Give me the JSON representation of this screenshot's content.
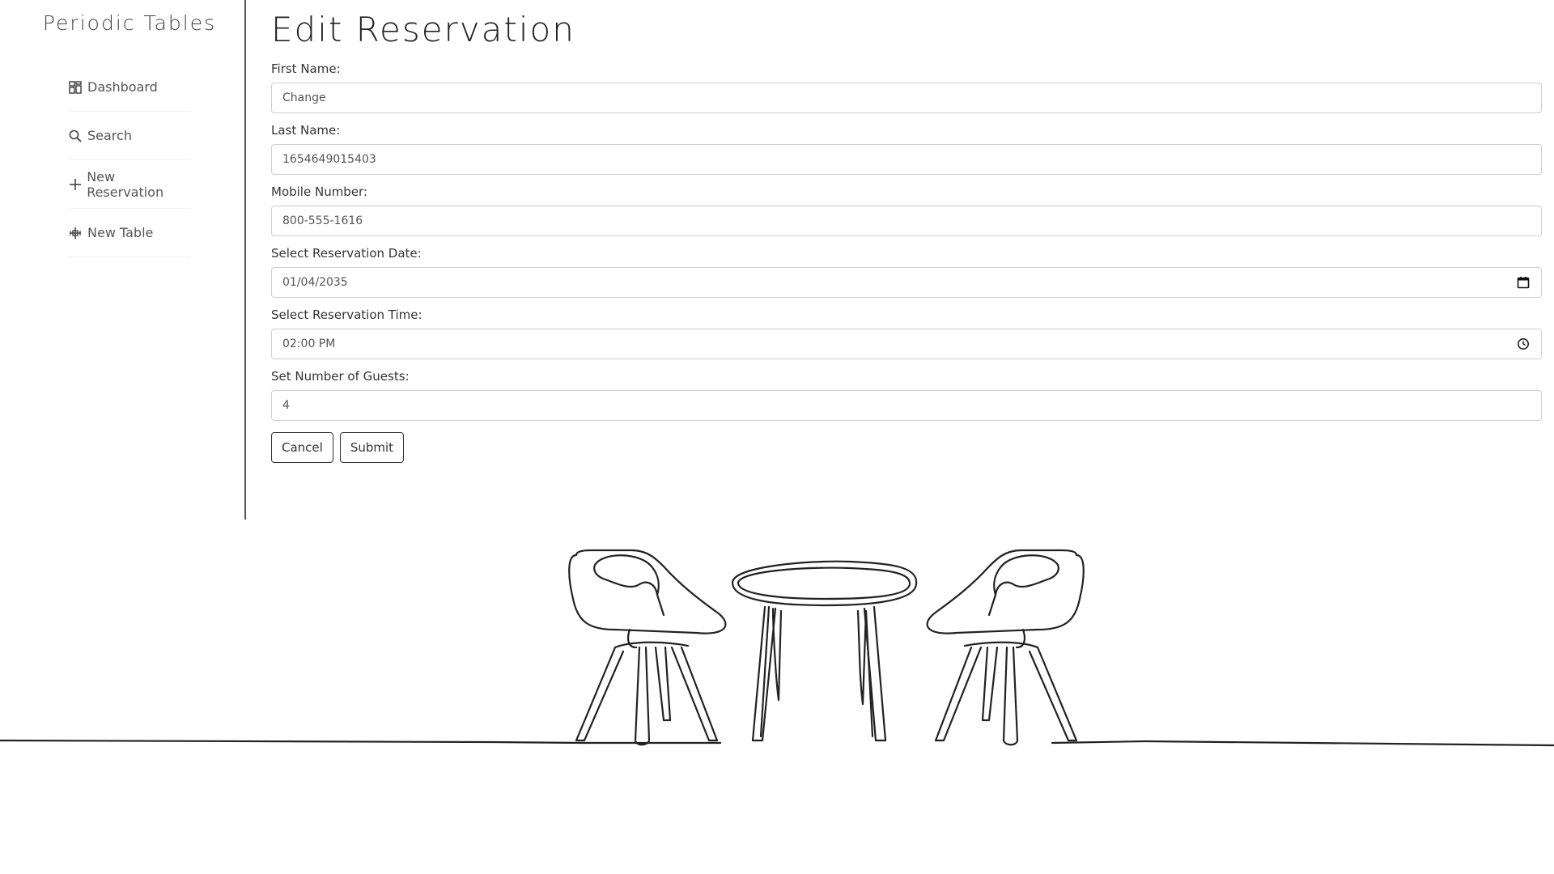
{
  "sidebar": {
    "title": "Periodic Tables",
    "items": [
      {
        "label": "Dashboard",
        "icon": "dashboard-icon"
      },
      {
        "label": "Search",
        "icon": "search-icon"
      },
      {
        "label": "New Reservation",
        "icon": "plus-icon"
      },
      {
        "label": "New Table",
        "icon": "table-icon"
      }
    ]
  },
  "main": {
    "title": "Edit Reservation",
    "fields": [
      {
        "label": "First Name:",
        "value": "Change"
      },
      {
        "label": "Last Name:",
        "value": "1654649015403"
      },
      {
        "label": "Mobile Number:",
        "value": "800-555-1616"
      },
      {
        "label": "Select Reservation Date:",
        "value": "01/04/2035",
        "icon": "calendar-icon"
      },
      {
        "label": "Select Reservation Time:",
        "value": "02:00 PM",
        "icon": "clock-icon"
      },
      {
        "label": "Set Number of Guests:",
        "value": "4"
      }
    ],
    "buttons": {
      "cancel": "Cancel",
      "submit": "Submit"
    }
  }
}
